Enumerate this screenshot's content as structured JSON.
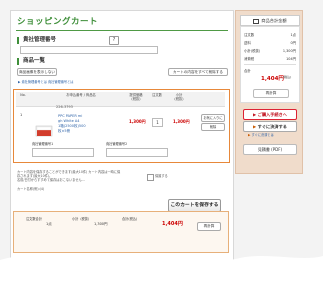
{
  "page": {
    "title": "ショッピングカート"
  },
  "company": {
    "section": "貴社管理番号",
    "help": "?"
  },
  "items": {
    "section": "商品一覧",
    "show_all_btn": "商品画像を表示しない",
    "clear_btn": "カートの内容をすべて削除する",
    "link_text": "▶ 貴社管理番号とは  貴社管理番号とは",
    "headers": {
      "no": "No.",
      "name": "お申込番号 / 商品名",
      "unit": "提供価格\n(税抜)",
      "qty": "注文数",
      "subtotal": "小計\n(税抜)"
    },
    "row": {
      "no": "1",
      "code": "226-3793",
      "name_l1": "PPC PAPER mi",
      "name_l2": "gh White A4",
      "name_l3": "1箱(2500枚)500",
      "name_l4": "枚×5冊",
      "unit_price": "1,300円",
      "qty": "1",
      "subtotal": "1,300円",
      "fav_btn": "お気に入りに",
      "del_btn": "削除",
      "note_label_1": "貴社管理番号1",
      "note_label_2": "貴社管理番号2"
    }
  },
  "save_area": {
    "note_l1": "カート内容を保存することができます(最大10件) カート内容は一時に保",
    "note_l2": "存されます(最大10件)。",
    "note_l3": "名前/日付からすすめて保存はおこないません...",
    "checkbox_label": "保護する",
    "save_button": "このカートを保存する",
    "cart_name": "カート名称(例):(4)"
  },
  "summary": {
    "col1": "注文数合計",
    "col2": "小計（税抜）",
    "col3": "合計(税込)",
    "qty": "1点",
    "subtotal": "1,300円",
    "total": "1,404円",
    "recalc_btn": "再計算"
  },
  "side": {
    "header": "商品合計金額",
    "rows": [
      {
        "label": "注文数",
        "value": "1点"
      },
      {
        "label": "送料",
        "value": "0円"
      },
      {
        "label": "小計(税抜)",
        "value": "1,300円"
      },
      {
        "label": "消費税",
        "value": "104円"
      }
    ],
    "total_label": "合計",
    "total_value": "1,404円",
    "total_note": "(税込)",
    "recalc_btn": "再計算",
    "order_btn": "ご購入手続きへ",
    "quick_btn": "すぐに決済する",
    "quick_link": "すぐに決済とは",
    "estimate_btn": "見積書 (PDF)"
  }
}
